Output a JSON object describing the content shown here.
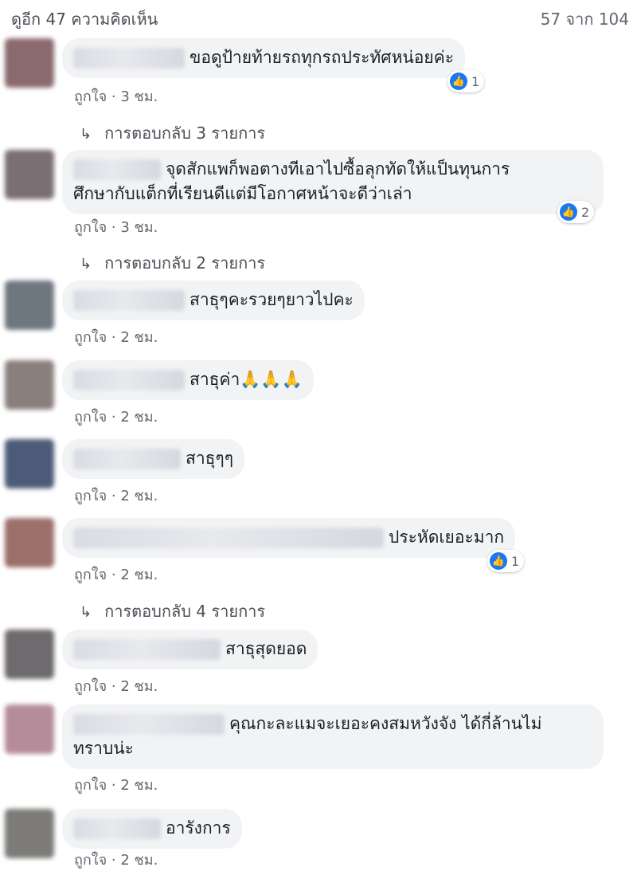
{
  "header": {
    "view_more": "ดูอีก 47 ความคิดเห็น",
    "count": "57 จาก 104"
  },
  "comments": [
    {
      "text": "ขอดูป้ายท้ายรถทุกรถประทัศหน่อยค่ะ",
      "reactions": "1",
      "like": "ถูกใจ",
      "time": "3 ชม.",
      "replies": "การตอบกลับ 3 รายการ",
      "avatar_color": "#8a6a6e"
    },
    {
      "text_line1": "จุดสักแพก็พอตางทีเอาไปซื้อลุกทัดให้แป็นทุนการ",
      "text_line2": "ศึกษากับแต็กที่เรียนดีแต่มีโอกาศหน้าจะดีว่าเล่า",
      "reactions": "2",
      "like": "ถูกใจ",
      "time": "3 ชม.",
      "replies": "การตอบกลับ 2 รายการ",
      "avatar_color": "#7c6f73"
    },
    {
      "text": "สาธุๆคะรวยๆยาวไปคะ",
      "like": "ถูกใจ",
      "time": "2 ชม.",
      "avatar_color": "#6e7680"
    },
    {
      "text": "สาธุค่า🙏🙏🙏",
      "like": "ถูกใจ",
      "time": "2 ชม.",
      "avatar_color": "#8a7f7d"
    },
    {
      "text": "สาธุๆๆ",
      "like": "ถูกใจ",
      "time": "2 ชม.",
      "avatar_color": "#4d5b78"
    },
    {
      "text": "ประหัดเยอะมาก",
      "reactions": "1",
      "like": "ถูกใจ",
      "time": "2 ชม.",
      "replies": "การตอบกลับ 4 รายการ",
      "avatar_color": "#9c6f6a"
    },
    {
      "text": "สาธุสุดยอด",
      "like": "ถูกใจ",
      "time": "2 ชม.",
      "avatar_color": "#6f6a6d"
    },
    {
      "text_line1": "คุณกะละแมจะเยอะคงสมหวังจัง ได้กี่ล้านไม่",
      "text_line2": "ทราบน่ะ",
      "like": "ถูกใจ",
      "time": "2 ชม.",
      "avatar_color": "#b58c9a"
    },
    {
      "text": "อารังการ",
      "like": "ถูกใจ",
      "time": "2 ชม.",
      "avatar_color": "#7d7b78"
    }
  ],
  "colors": {
    "accent": "#1877f2",
    "bubble": "#f2f3f5",
    "meta": "#606770"
  },
  "icons": {
    "like": "like-thumb-icon",
    "reply": "reply-arrow-icon"
  }
}
